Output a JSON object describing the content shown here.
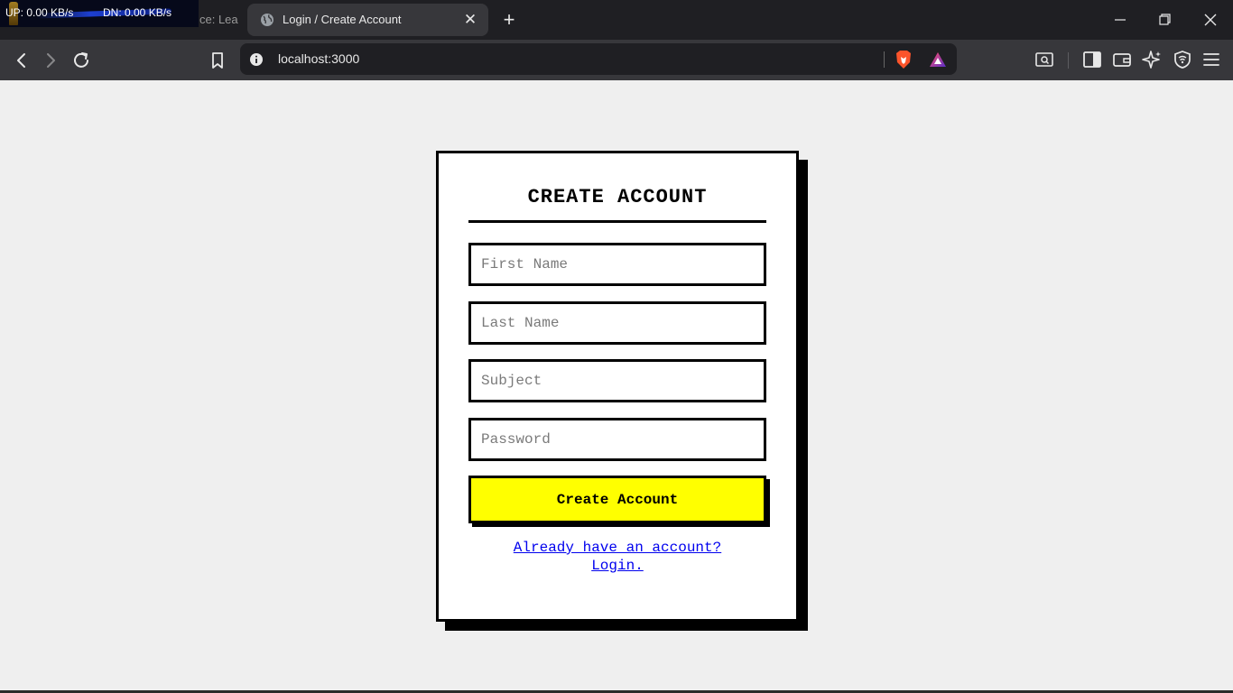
{
  "system": {
    "net_up": "UP: 0.00 KB/s",
    "net_down": "DN: 0.00 KB/s"
  },
  "browser": {
    "prev_tab_title": "ce: Lea",
    "active_tab_title": "Login / Create Account",
    "url": "localhost:3000",
    "icons": {
      "tab": "globe-icon",
      "back": "back-icon",
      "forward": "forward-icon",
      "reload": "reload-icon",
      "bookmark": "bookmark-icon",
      "site_info": "info-icon",
      "brave_shields": "brave-lion-icon",
      "rewards": "rewards-triangle-icon",
      "toolbar": [
        "screenshot-search-icon",
        "sidebar-icon",
        "wallet-icon",
        "leo-ai-icon",
        "vpn-shield-icon",
        "menu-icon"
      ]
    },
    "colors": {
      "tabbar": "#1f1f23",
      "toolbar": "#37373b",
      "brave_orange": "#fb542b"
    }
  },
  "form": {
    "title": "CREATE ACCOUNT",
    "fields": [
      {
        "placeholder": "First Name",
        "value": ""
      },
      {
        "placeholder": "Last Name",
        "value": ""
      },
      {
        "placeholder": "Subject",
        "value": ""
      },
      {
        "placeholder": "Password",
        "value": ""
      }
    ],
    "submit_label": "Create Account",
    "login_link_line1": "Already have an account?",
    "login_link_line2": "Login."
  },
  "colors": {
    "page_bg": "#efefef",
    "button_bg": "#ffff00",
    "link": "#0000ee",
    "border": "#000000"
  }
}
